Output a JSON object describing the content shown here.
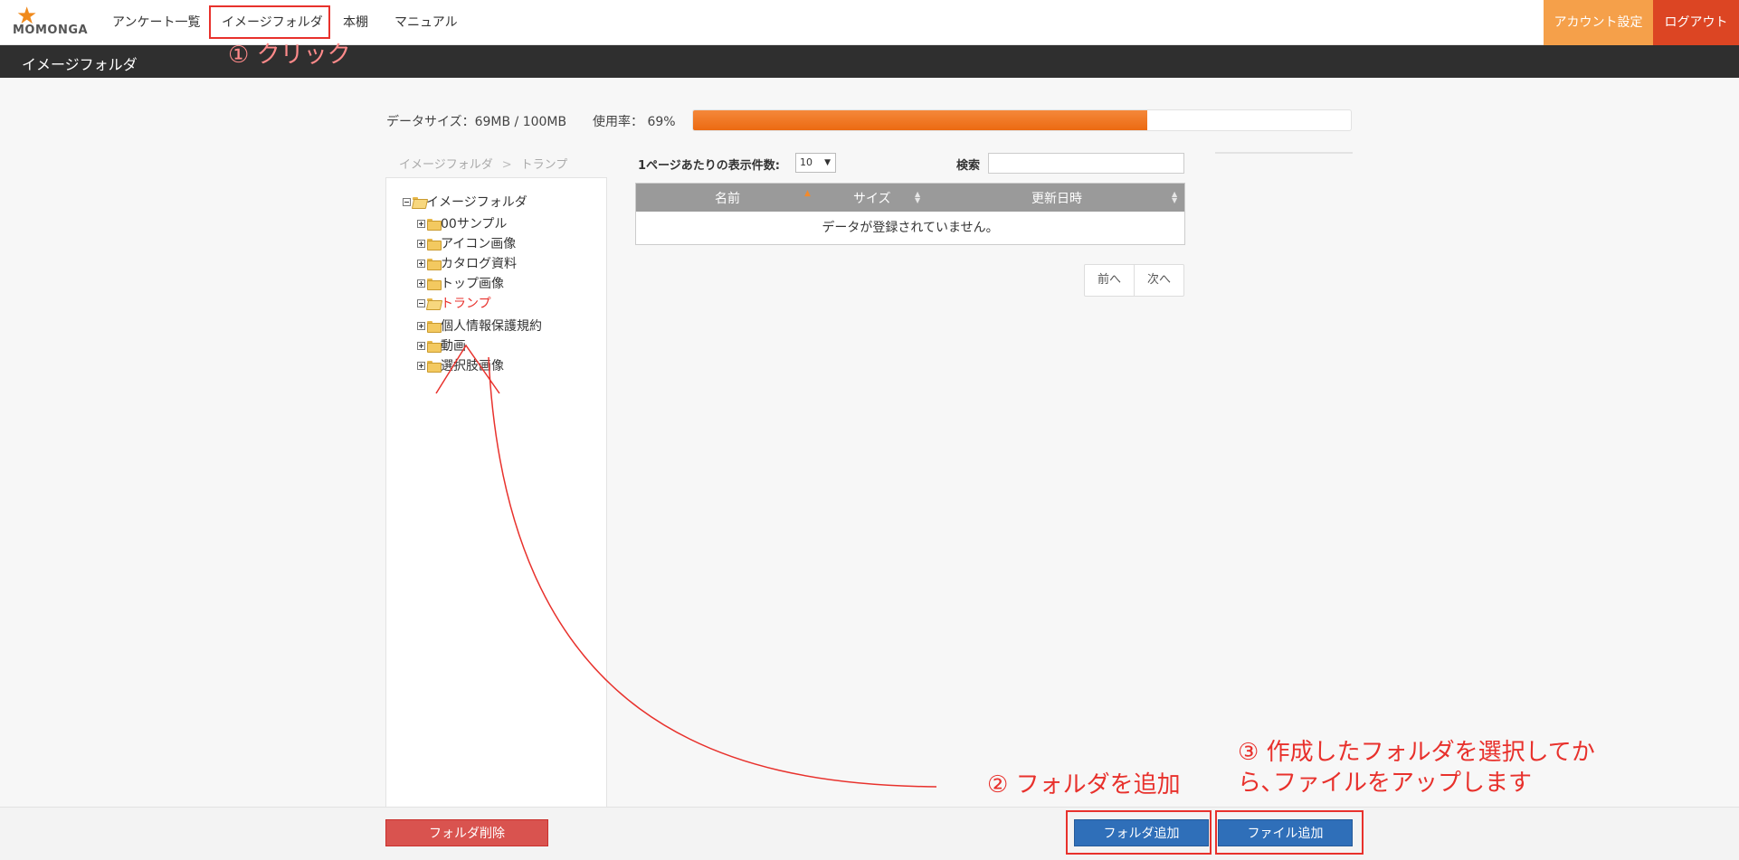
{
  "header": {
    "logo_text": "MOMONGA",
    "nav": [
      "アンケート一覧",
      "イメージフォルダ",
      "本棚",
      "マニュアル"
    ],
    "account_label": "アカウント設定",
    "logout_label": "ログアウト"
  },
  "subheader": {
    "title": "イメージフォルダ"
  },
  "usage": {
    "size_text": "データサイズ：69MB / 100MB",
    "rate_text": "使用率： 69%",
    "percent": 69
  },
  "breadcrumb": [
    "イメージフォルダ",
    "トランプ"
  ],
  "breadcrumb_sep": ">",
  "tree": {
    "root": "イメージフォルダ",
    "children": [
      "00サンプル",
      "アイコン画像",
      "カタログ資料",
      "トップ画像",
      "トランプ",
      "個人情報保護規約",
      "動画",
      "選択肢画像"
    ],
    "selected": "トランプ"
  },
  "table": {
    "perpage_label": "1ページあたりの表示件数:",
    "perpage_value": "10",
    "search_label": "検索",
    "search_value": "",
    "columns": [
      "名前",
      "サイズ",
      "更新日時"
    ],
    "empty_message": "データが登録されていません。",
    "prev_label": "前へ",
    "next_label": "次へ"
  },
  "footer": {
    "delete_label": "フォルダ削除",
    "add_folder_label": "フォルダ追加",
    "add_file_label": "ファイル追加"
  },
  "annotations": {
    "step1": "① クリック",
    "step2": "② フォルダを追加",
    "step3_line1": "③ 作成したフォルダを選択してか",
    "step3_line2": "ら､ファイルをアップします"
  }
}
